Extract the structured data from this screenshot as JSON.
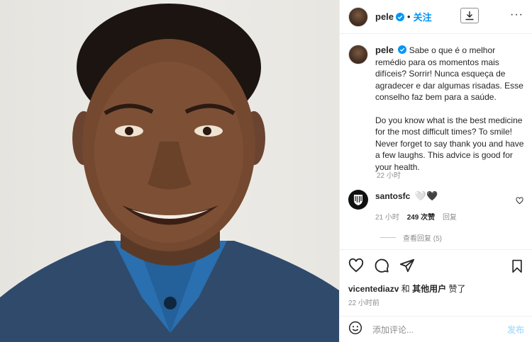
{
  "header": {
    "username": "pele",
    "separator": "•",
    "follow_label": "关注",
    "more_label": "···"
  },
  "caption": {
    "username": "pele",
    "text_pt": "Sabe o que é o melhor remédio para os momentos mais difíceis? Sorrir! Nunca esqueça de agradecer e dar algumas risadas. Esse conselho faz bem para a saúde.",
    "text_en": "Do you know what is the best medicine for the most difficult times? To smile! Never forget to say thank you and have a few laughs. This advice is good for your health.",
    "time": "22 小时"
  },
  "comment": {
    "username": "santosfc",
    "hearts": "🤍🖤",
    "time": "21 小时",
    "likes": "249 次赞",
    "reply_label": "回复",
    "view_replies": "查看回复 (5)"
  },
  "likes": {
    "first_user": "vicentediazv",
    "connector": "和",
    "others": "其他用户",
    "suffix": "赞了"
  },
  "post_time": "22 小时前",
  "add_comment": {
    "placeholder": "添加评论...",
    "post_label": "发布"
  },
  "colors": {
    "accent": "#0095f6",
    "post_disabled": "#b2dffc",
    "jacket": "#2f4a6b",
    "shirt": "#2a6fb0",
    "background_photo": "#e8e6e1"
  }
}
